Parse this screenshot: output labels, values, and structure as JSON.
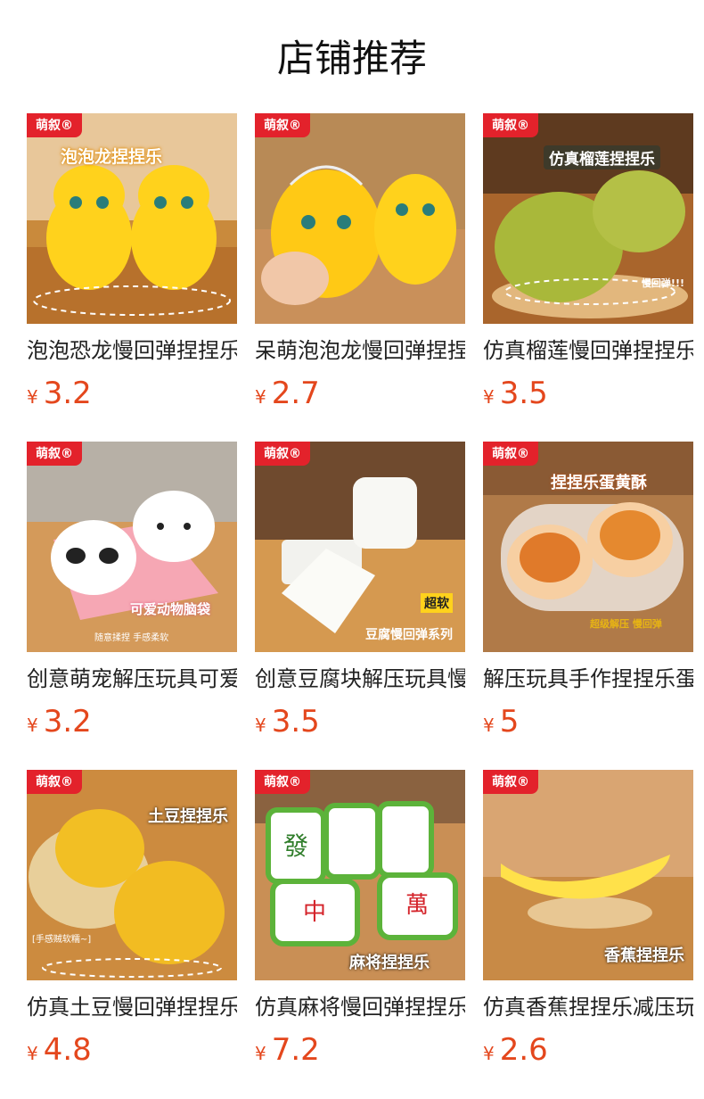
{
  "header": {
    "title": "店铺推荐"
  },
  "brand_badge": "萌叙®",
  "products": [
    {
      "name": "泡泡恐龙慢回弹捏捏乐",
      "currency": "¥",
      "price": "3.2",
      "image_text": "泡泡龙捏捏乐",
      "image_icon": "yellow-dinosaur-toys-image"
    },
    {
      "name": "呆萌泡泡龙慢回弹捏捏乐",
      "currency": "¥",
      "price": "2.7",
      "image_text": "",
      "image_icon": "yellow-dinosaur-net-image"
    },
    {
      "name": "仿真榴莲慢回弹捏捏乐",
      "currency": "¥",
      "price": "3.5",
      "image_text": "仿真榴莲捏捏乐",
      "image_icon": "durian-toy-image"
    },
    {
      "name": "创意萌宠解压玩具可爱",
      "currency": "¥",
      "price": "3.2",
      "image_text": "可爱动物脑袋",
      "image_icon": "panda-cat-heads-image"
    },
    {
      "name": "创意豆腐块解压玩具慢",
      "currency": "¥",
      "price": "3.5",
      "image_text": "豆腐慢回弹系列",
      "image_icon": "tofu-blocks-image"
    },
    {
      "name": "解压玩具手作捏捏乐蛋",
      "currency": "¥",
      "price": "5",
      "image_text": "捏捏乐蛋黄酥",
      "image_icon": "egg-yolk-pastry-image"
    },
    {
      "name": "仿真土豆慢回弹捏捏乐",
      "currency": "¥",
      "price": "4.8",
      "image_text": "土豆捏捏乐",
      "image_icon": "potato-toys-image"
    },
    {
      "name": "仿真麻将慢回弹捏捏乐",
      "currency": "¥",
      "price": "7.2",
      "image_text": "麻将捏捏乐",
      "image_icon": "mahjong-tiles-image"
    },
    {
      "name": "仿真香蕉捏捏乐减压玩",
      "currency": "¥",
      "price": "2.6",
      "image_text": "香蕉捏捏乐",
      "image_icon": "banana-toy-image"
    }
  ],
  "image_badges": {
    "p2": "慢回弹!!!",
    "p4": "超软",
    "p5": "超级解压 慢回弹",
    "p6": "[手感贼软糯~]",
    "p3sub": "随意揉捏 手感柔软"
  }
}
